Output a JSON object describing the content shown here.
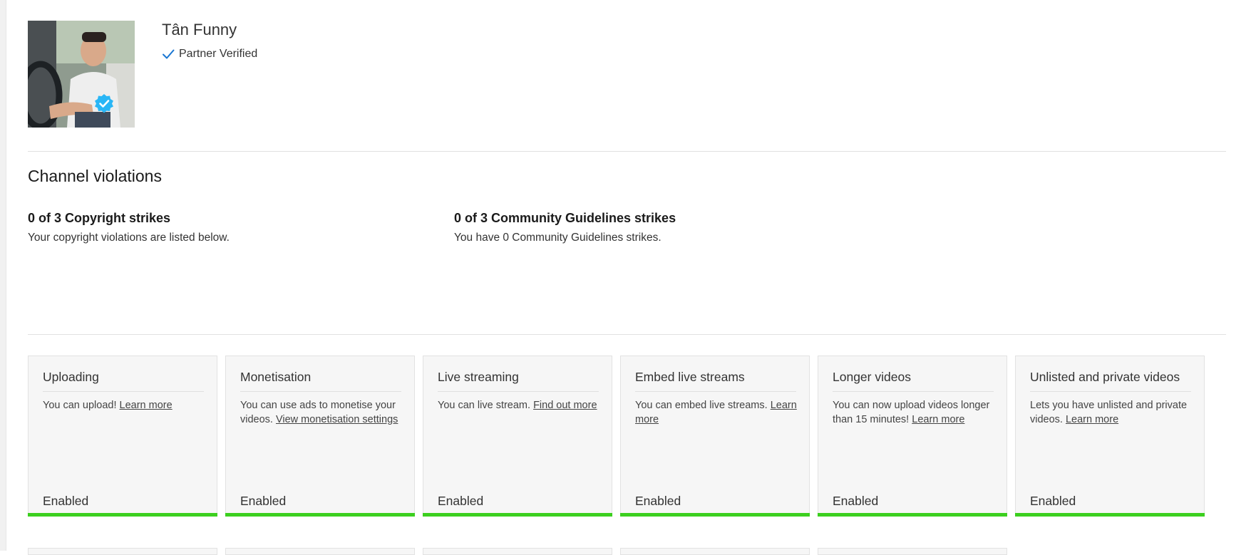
{
  "channel": {
    "name": "Tân Funny",
    "partner_status": "Partner Verified"
  },
  "violations": {
    "title": "Channel violations",
    "copyright": {
      "title": "0 of 3 Copyright strikes",
      "description": "Your copyright violations are listed below."
    },
    "community": {
      "title": "0 of 3 Community Guidelines strikes",
      "description": "You have 0 Community Guidelines strikes."
    }
  },
  "features": [
    {
      "title": "Uploading",
      "text": "You can upload! ",
      "link": "Learn more",
      "status": "Enabled"
    },
    {
      "title": "Monetisation",
      "text": "You can use ads to monetise your videos. ",
      "link": "View monetisation settings",
      "status": "Enabled"
    },
    {
      "title": "Live streaming",
      "text": "You can live stream. ",
      "link": "Find out more",
      "status": "Enabled"
    },
    {
      "title": "Embed live streams",
      "text": "You can embed live streams. ",
      "link": "Learn more",
      "status": "Enabled"
    },
    {
      "title": "Longer videos",
      "text": "You can now upload videos longer than 15 minutes! ",
      "link": "Learn more",
      "status": "Enabled"
    },
    {
      "title": "Unlisted and private videos",
      "text": "Lets you have unlisted and private videos. ",
      "link": "Learn more",
      "status": "Enabled"
    }
  ],
  "colors": {
    "enabled_bar": "#3ccf1f",
    "verified_badge": "#29b6f6",
    "check": "#1976d2"
  },
  "icons": {
    "verified": "verified-badge-icon",
    "partner_check": "checkmark-icon"
  }
}
